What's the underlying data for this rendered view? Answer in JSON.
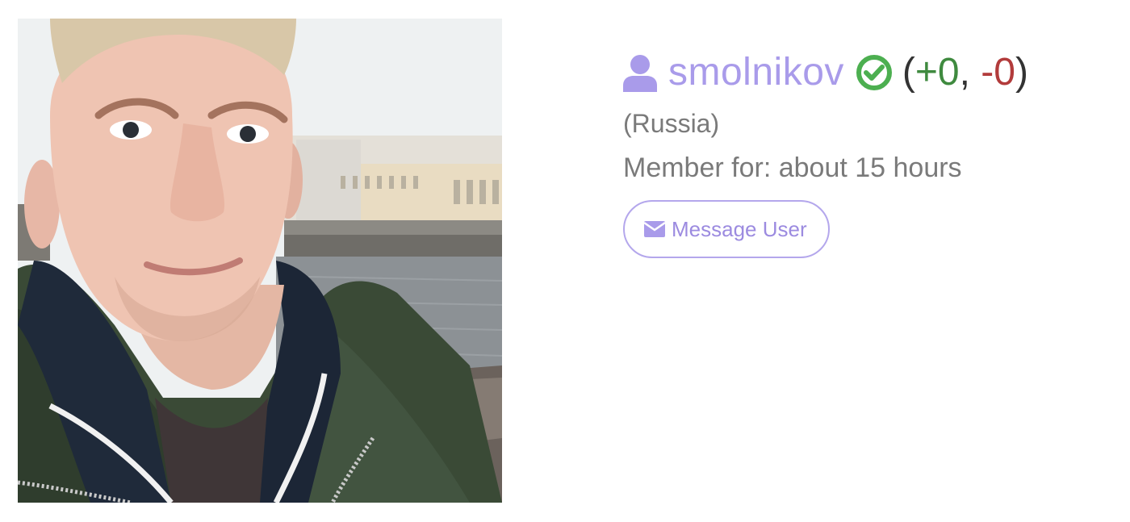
{
  "profile": {
    "username": "smolnikov",
    "score_open": "(",
    "score_plus": "+0",
    "score_sep": ", ",
    "score_minus": "-0",
    "score_close": ")",
    "location": "(Russia)",
    "member_since": "Member for: about 15 hours",
    "message_button_label": "Message User"
  },
  "icons": {
    "user": "user-icon",
    "verified": "check-circle-icon",
    "message": "envelope-icon"
  },
  "colors": {
    "username": "#a99bea",
    "verified": "#4caf50",
    "positive": "#3f8a3f",
    "negative": "#b23b3b",
    "muted_text": "#7a7a7a",
    "button_border": "#b4a7ec"
  }
}
